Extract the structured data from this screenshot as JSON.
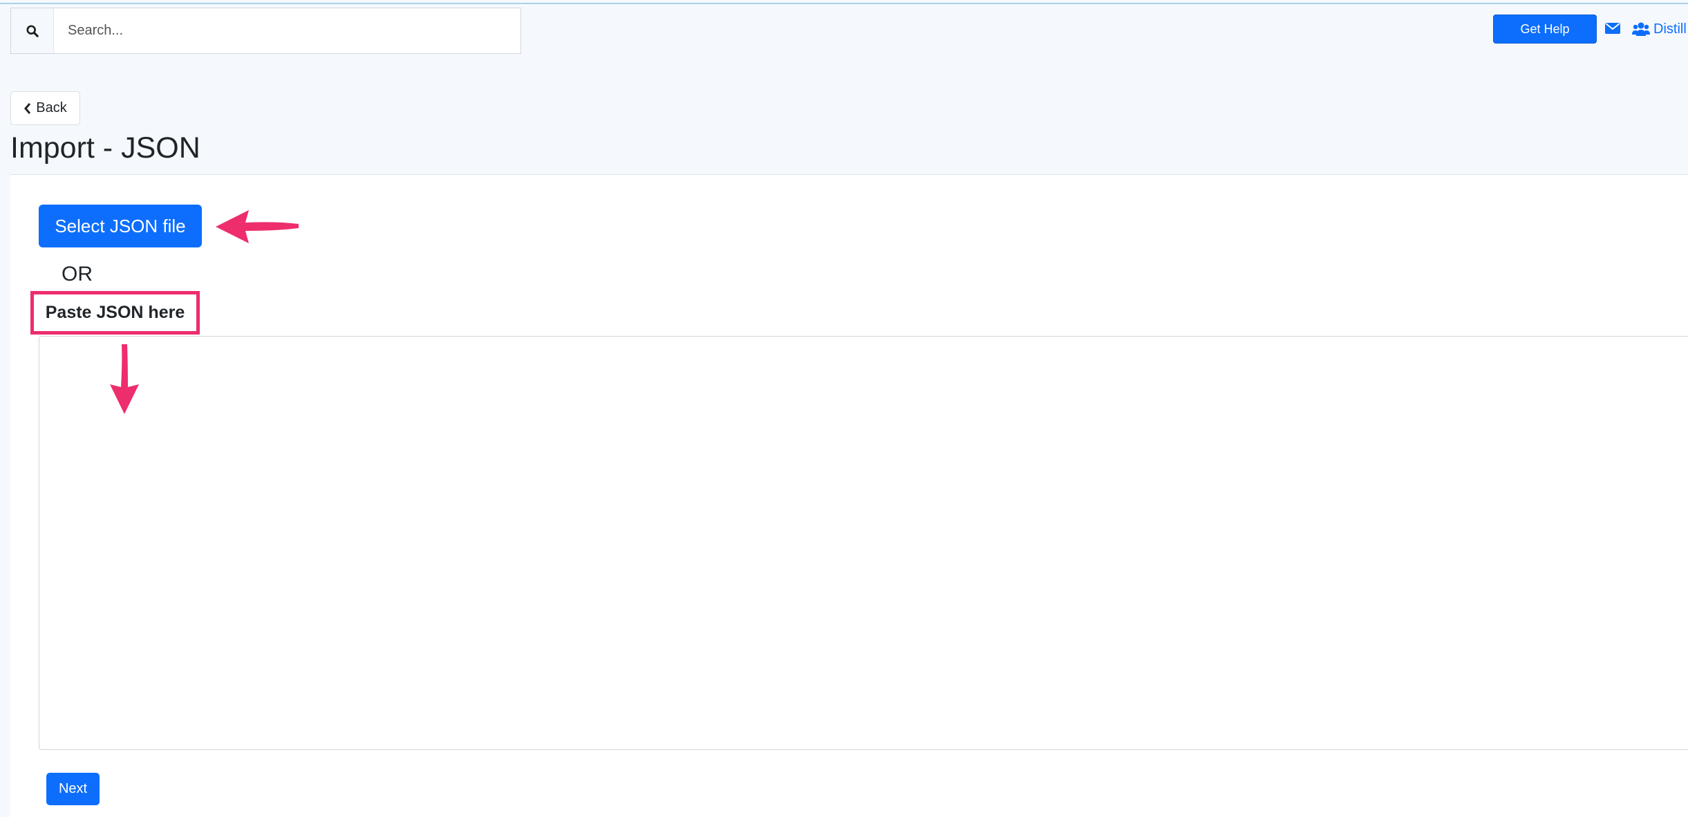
{
  "header": {
    "search_placeholder": "Search...",
    "get_help_label": "Get Help",
    "team_link_label": "Distill",
    "accent_color": "#0d6efd"
  },
  "nav": {
    "back_label": "Back"
  },
  "page": {
    "title": "Import - JSON"
  },
  "import_form": {
    "select_file_label": "Select JSON file",
    "or_label": "OR",
    "paste_label": "Paste JSON here",
    "json_value": "",
    "next_label": "Next"
  },
  "annotations": {
    "highlight_color": "#ee2d6c"
  }
}
